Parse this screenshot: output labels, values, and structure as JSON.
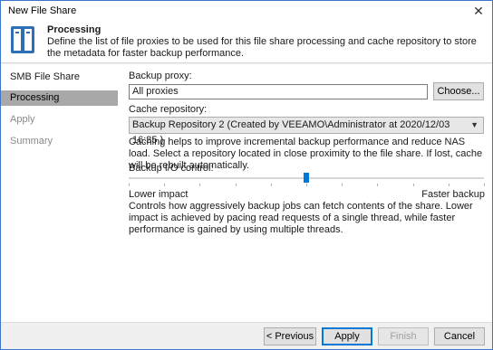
{
  "window": {
    "title": "New File Share",
    "close_glyph": "✕"
  },
  "header": {
    "title": "Processing",
    "description": "Define the list of file proxies to be used for this file share processing and cache repository to store the metadata for faster backup performance."
  },
  "sidebar": {
    "items": [
      {
        "label": "SMB File Share",
        "state": "normal"
      },
      {
        "label": "Processing",
        "state": "active"
      },
      {
        "label": "Apply",
        "state": "disabled"
      },
      {
        "label": "Summary",
        "state": "disabled"
      }
    ]
  },
  "main": {
    "backup_proxy": {
      "label": "Backup proxy:",
      "value": "All proxies",
      "choose_label": "Choose..."
    },
    "cache_repository": {
      "label": "Cache repository:",
      "value": "Backup Repository 2 (Created by VEEAMO\\Administrator at 2020/12/03 16:35.)",
      "help": "Caching helps to improve incremental backup performance and reduce NAS load. Select a repository located in close proximity to the file share. If lost, cache will be rebuilt automatically."
    },
    "io_control": {
      "label": "Backup I/O control:",
      "value_fraction": 0.5,
      "min_label": "Lower impact",
      "max_label": "Faster backup",
      "help": "Controls how aggressively backup jobs can fetch contents of the share. Lower impact is achieved by pacing read requests of a single thread, while faster performance is gained by using multiple threads."
    }
  },
  "footer": {
    "previous": "< Previous",
    "apply": "Apply",
    "finish": "Finish",
    "cancel": "Cancel"
  },
  "colors": {
    "accent": "#0078d7",
    "active_nav": "#a8a8a8",
    "window_border": "#3a76c9"
  }
}
